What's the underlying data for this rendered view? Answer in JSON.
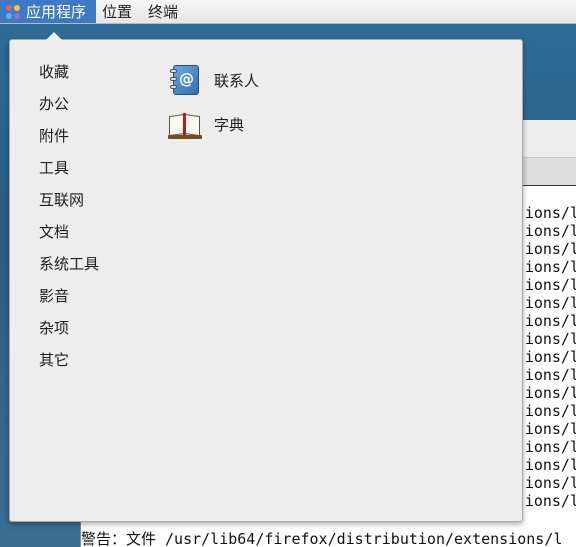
{
  "top_panel": {
    "menus": [
      "应用程序",
      "位置",
      "终端"
    ]
  },
  "applications_menu": {
    "categories": [
      "收藏",
      "办公",
      "附件",
      "工具",
      "互联网",
      "文档",
      "系统工具",
      "影音",
      "杂项",
      "其它"
    ],
    "apps": [
      {
        "label": "联系人",
        "icon": "contacts-icon"
      },
      {
        "label": "字典",
        "icon": "dictionary-icon"
      }
    ]
  },
  "terminal": {
    "line_fragment": "ions/l",
    "last_line": "警告：文件 /usr/lib64/firefox/distribution/extensions/l"
  },
  "colors": {
    "panel_active": "#3d79c4",
    "menu_bg": "#ededed",
    "desktop": "#2f6f9a"
  }
}
